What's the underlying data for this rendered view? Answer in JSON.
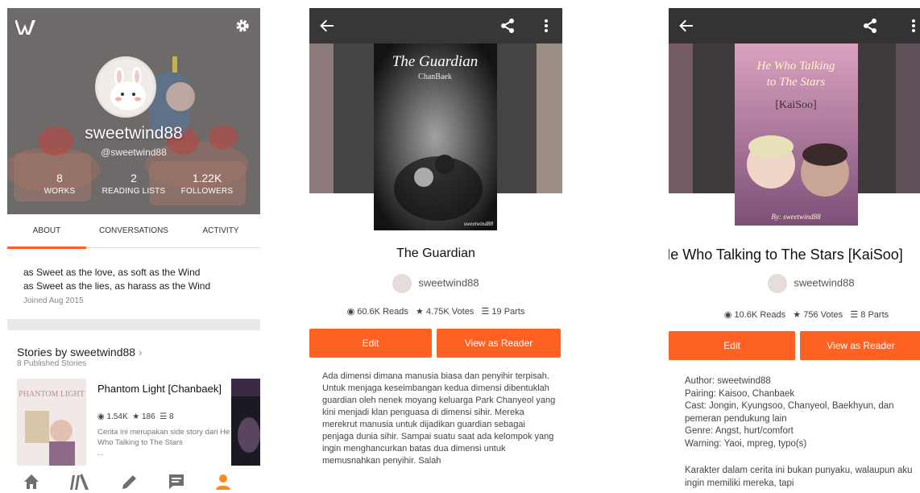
{
  "profile": {
    "username": "sweetwind88",
    "handle": "@sweetwind88",
    "stats": [
      {
        "value": "8",
        "label": "WORKS"
      },
      {
        "value": "2",
        "label": "READING LISTS"
      },
      {
        "value": "1.22K",
        "label": "FOLLOWERS"
      }
    ],
    "tabs": [
      "ABOUT",
      "CONVERSATIONS",
      "ACTIVITY"
    ],
    "about_line1": "as Sweet as the love, as soft as the Wind",
    "about_line2": "as Sweet as the lies, as harass as the Wind",
    "joined": "Joined Aug 2015",
    "stories_title": "Stories by sweetwind88",
    "stories_chevron": "›",
    "stories_count": "8 Published Stories",
    "story": {
      "cover_text": "PHANTOM LIGHT",
      "title": "Phantom Light [Chanbaek]",
      "reads": "1.54K",
      "votes": "186",
      "parts": "8",
      "description": "Cerita ini merupakan side story dari He Who Talking to The Stars",
      "ellipsis": "..."
    }
  },
  "story1": {
    "cover_title": "The Guardian",
    "cover_sub": "ChanBaek",
    "cover_credit": "sweetwind88",
    "title": "The Guardian",
    "author": "sweetwind88",
    "reads": "60.6K Reads",
    "votes": "4.75K Votes",
    "parts": "19 Parts",
    "edit_label": "Edit",
    "reader_label": "View as Reader",
    "description": "Ada dimensi dimana manusia biasa dan penyihir terpisah. Untuk menjaga keseimbangan kedua dimensi dibentuklah guardian oleh nenek moyang keluarga Park Chanyeol yang kini menjadi klan penguasa di dimensi sihir. Mereka merekrut manusia untuk dijadikan guardian sebagai penjaga dunia sihir. Sampai suatu saat ada kelompok yang ingin menghancurkan batas dua dimensi untuk memusnahkan penyihir. Salah"
  },
  "story2": {
    "cover_title_1": "He Who Talking",
    "cover_title_2": "to The Stars",
    "cover_title_3": "[KaiSoo]",
    "cover_credit": "By: sweetwind88",
    "title": "He Who Talking to The Stars [KaiSoo]",
    "author": "sweetwind88",
    "reads": "10.6K Reads",
    "votes": "756 Votes",
    "parts": "8 Parts",
    "edit_label": "Edit",
    "reader_label": "View as Reader",
    "description_1": "Author: sweetwind88\nPairing: Kaisoo, Chanbaek\nCast: Jongin, Kyungsoo, Chanyeol, Baekhyun, dan pemeran pendukung lain\nGenre: Angst, hurt/comfort\nWarning: Yaoi, mpreg, typo(s)",
    "description_2": "Karakter dalam cerita ini bukan punyaku, walaupun aku ingin memiliki mereka, tapi"
  },
  "colors": {
    "accent": "#ff6122",
    "icon_grey": "#6f6f6f",
    "active_nav": "#ff8a1e"
  },
  "icons": {
    "logo": "wattpad-logo-icon",
    "settings": "gear-icon",
    "back": "arrow-left-icon",
    "share": "share-icon",
    "more": "more-vertical-icon",
    "reads": "eye-icon",
    "votes": "star-icon",
    "parts": "list-icon",
    "nav": [
      "home-icon",
      "library-icon",
      "write-icon",
      "messages-icon",
      "profile-icon"
    ]
  }
}
